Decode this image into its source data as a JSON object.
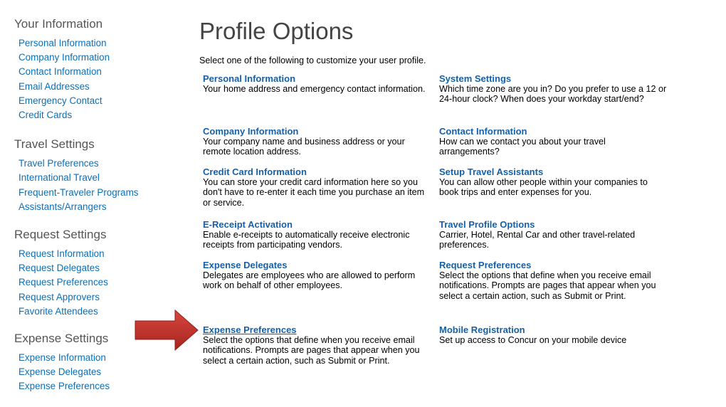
{
  "sidebar": {
    "sections": [
      {
        "heading": "Your Information",
        "items": [
          "Personal Information",
          "Company Information",
          "Contact Information",
          "Email Addresses",
          "Emergency Contact",
          "Credit Cards"
        ]
      },
      {
        "heading": "Travel Settings",
        "items": [
          "Travel Preferences",
          "International Travel",
          "Frequent-Traveler Programs",
          "Assistants/Arrangers"
        ]
      },
      {
        "heading": "Request Settings",
        "items": [
          "Request Information",
          "Request Delegates",
          "Request Preferences",
          "Request Approvers",
          "Favorite Attendees"
        ]
      },
      {
        "heading": "Expense Settings",
        "items": [
          "Expense Information",
          "Expense Delegates",
          "Expense Preferences"
        ]
      }
    ]
  },
  "main": {
    "title": "Profile Options",
    "intro": "Select one of the following to customize your user profile.",
    "options": {
      "personal": {
        "title": "Personal Information",
        "desc": "Your home address and emergency contact information."
      },
      "system": {
        "title": "System Settings",
        "desc": "Which time zone are you in? Do you prefer to use a 12 or 24-hour clock? When does your workday start/end?"
      },
      "company": {
        "title": "Company Information",
        "desc": "Your company name and business address or your remote location address."
      },
      "contact": {
        "title": "Contact Information",
        "desc": "How can we contact you about your travel arrangements?"
      },
      "credit": {
        "title": "Credit Card Information",
        "desc": "You can store your credit card information here so you don't have to re-enter it each time you purchase an item or service."
      },
      "assistants": {
        "title": "Setup Travel Assistants",
        "desc": "You can allow other people within your companies to book trips and enter expenses for you."
      },
      "ereceipt": {
        "title": "E-Receipt Activation",
        "desc": "Enable e-receipts to automatically receive electronic receipts from participating vendors."
      },
      "travelprofile": {
        "title": "Travel Profile Options",
        "desc": "Carrier, Hotel, Rental Car and other travel-related preferences."
      },
      "expdelegates": {
        "title": "Expense Delegates",
        "desc": "Delegates are employees who are allowed to perform work on behalf of other employees."
      },
      "reqprefs": {
        "title": "Request Preferences",
        "desc": "Select the options that define when you receive email notifications. Prompts are pages that appear when you select a certain action, such as Submit or Print."
      },
      "expprefs": {
        "title": "Expense Preferences",
        "desc": "Select the options that define when you receive email notifications. Prompts are pages that appear when you select a certain action, such as Submit or Print."
      },
      "mobile": {
        "title": "Mobile Registration",
        "desc": "Set up access to Concur on your mobile device"
      }
    }
  },
  "colors": {
    "link": "#0b6fb8",
    "heading": "#555555",
    "arrow": "#c0312b"
  }
}
